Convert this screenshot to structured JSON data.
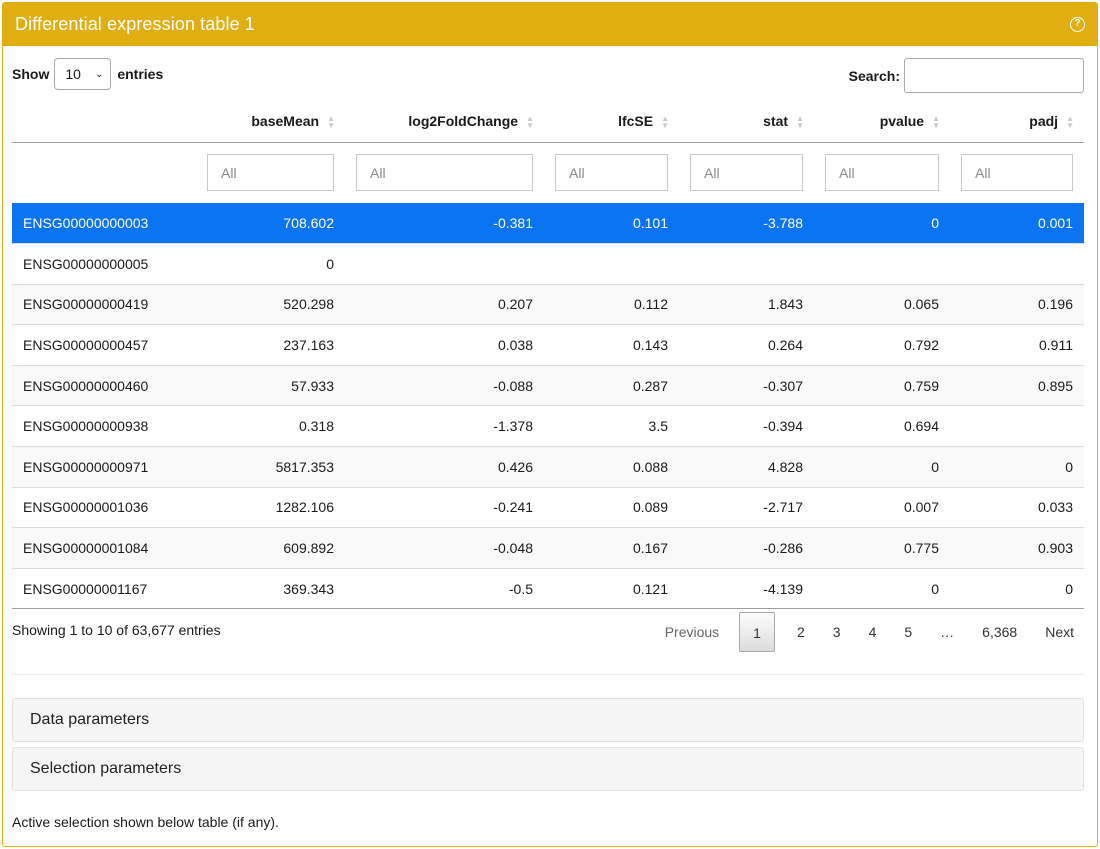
{
  "panel": {
    "title": "Differential expression table 1",
    "help_icon": "question-circle-icon"
  },
  "length": {
    "show_label": "Show",
    "value": "10",
    "entries_label": "entries"
  },
  "search": {
    "label": "Search:",
    "value": ""
  },
  "table": {
    "columns": [
      "",
      "baseMean",
      "log2FoldChange",
      "lfcSE",
      "stat",
      "pvalue",
      "padj"
    ],
    "filter_placeholder": "All",
    "rows": [
      [
        "ENSG00000000003",
        "708.602",
        "-0.381",
        "0.101",
        "-3.788",
        "0",
        "0.001"
      ],
      [
        "ENSG00000000005",
        "0",
        "",
        "",
        "",
        "",
        ""
      ],
      [
        "ENSG00000000419",
        "520.298",
        "0.207",
        "0.112",
        "1.843",
        "0.065",
        "0.196"
      ],
      [
        "ENSG00000000457",
        "237.163",
        "0.038",
        "0.143",
        "0.264",
        "0.792",
        "0.911"
      ],
      [
        "ENSG00000000460",
        "57.933",
        "-0.088",
        "0.287",
        "-0.307",
        "0.759",
        "0.895"
      ],
      [
        "ENSG00000000938",
        "0.318",
        "-1.378",
        "3.5",
        "-0.394",
        "0.694",
        ""
      ],
      [
        "ENSG00000000971",
        "5817.353",
        "0.426",
        "0.088",
        "4.828",
        "0",
        "0"
      ],
      [
        "ENSG00000001036",
        "1282.106",
        "-0.241",
        "0.089",
        "-2.717",
        "0.007",
        "0.033"
      ],
      [
        "ENSG00000001084",
        "609.892",
        "-0.048",
        "0.167",
        "-0.286",
        "0.775",
        "0.903"
      ],
      [
        "ENSG00000001167",
        "369.343",
        "-0.5",
        "0.121",
        "-4.139",
        "0",
        "0"
      ]
    ],
    "selected_row": 0
  },
  "info": "Showing 1 to 10 of 63,677 entries",
  "pagination": {
    "previous": "Previous",
    "pages": [
      "1",
      "2",
      "3",
      "4",
      "5"
    ],
    "ellipsis": "…",
    "last": "6,368",
    "next": "Next",
    "current": "1"
  },
  "sections": {
    "data_parameters": "Data parameters",
    "selection_parameters": "Selection parameters"
  },
  "note": "Active selection shown below table (if any).",
  "colors": {
    "header": "#e1ae12",
    "selected_row": "#0b74f2"
  }
}
